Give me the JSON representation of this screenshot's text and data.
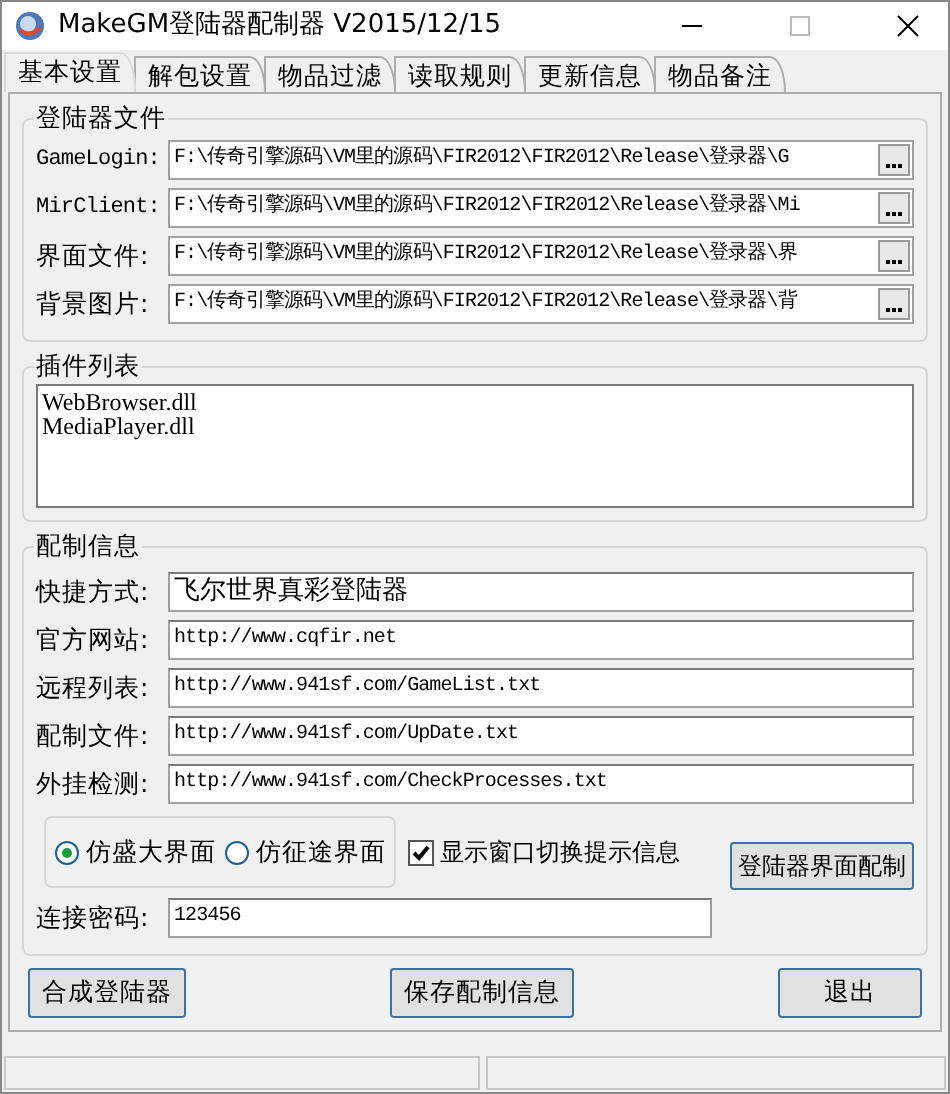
{
  "window": {
    "title": "MakeGM登陆器配制器 V2015/12/15"
  },
  "tabs": [
    {
      "label": "基本设置",
      "selected": true
    },
    {
      "label": "解包设置",
      "selected": false
    },
    {
      "label": "物品过滤",
      "selected": false
    },
    {
      "label": "读取规则",
      "selected": false
    },
    {
      "label": "更新信息",
      "selected": false
    },
    {
      "label": "物品备注",
      "selected": false
    }
  ],
  "login_files": {
    "title": "登陆器文件",
    "rows": [
      {
        "label": "GameLogin:",
        "value": "F:\\传奇引擎源码\\VM里的源码\\FIR2012\\FIR2012\\Release\\登录器\\G"
      },
      {
        "label": "MirClient:",
        "value": "F:\\传奇引擎源码\\VM里的源码\\FIR2012\\FIR2012\\Release\\登录器\\Mi"
      },
      {
        "label": "界面文件:",
        "value": "F:\\传奇引擎源码\\VM里的源码\\FIR2012\\FIR2012\\Release\\登录器\\界"
      },
      {
        "label": "背景图片:",
        "value": "F:\\传奇引擎源码\\VM里的源码\\FIR2012\\FIR2012\\Release\\登录器\\背"
      }
    ]
  },
  "plugins": {
    "title": "插件列表",
    "items": [
      "WebBrowser.dll",
      "MediaPlayer.dll"
    ]
  },
  "config": {
    "title": "配制信息",
    "rows": [
      {
        "label": "快捷方式:",
        "value": "飞尔世界真彩登陆器"
      },
      {
        "label": "官方网站:",
        "value": "http://www.cqfir.net"
      },
      {
        "label": "远程列表:",
        "value": "http://www.941sf.com/GameList.txt"
      },
      {
        "label": "配制文件:",
        "value": "http://www.941sf.com/UpDate.txt"
      },
      {
        "label": "外挂检测:",
        "value": "http://www.941sf.com/CheckProcesses.txt"
      }
    ],
    "styles": [
      {
        "label": "仿盛大界面",
        "selected": true
      },
      {
        "label": "仿征途界面",
        "selected": false
      }
    ],
    "show_hint": {
      "label": "显示窗口切换提示信息",
      "checked": true
    },
    "ui_button": "登陆器界面配制",
    "password": {
      "label": "连接密码:",
      "value": "123456"
    }
  },
  "buttons": [
    "合成登陆器",
    "保存配制信息",
    "退出"
  ]
}
